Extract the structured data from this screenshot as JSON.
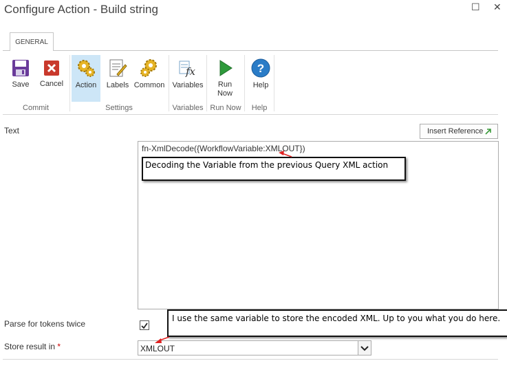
{
  "window": {
    "title": "Configure Action - Build string",
    "maximize_glyph": "☐",
    "close_glyph": "✕"
  },
  "ribbon": {
    "tab_label": "GENERAL",
    "buttons": {
      "save": "Save",
      "cancel": "Cancel",
      "action": "Action",
      "labels": "Labels",
      "common": "Common",
      "variables": "Variables",
      "run_now_1": "Run",
      "run_now_2": "Now",
      "help": "Help"
    },
    "groups": {
      "commit": "Commit",
      "settings": "Settings",
      "variables": "Variables",
      "run_now": "Run Now",
      "help": "Help"
    },
    "icons": [
      "save-icon",
      "cancel-icon",
      "action-gear-icon",
      "labels-icon",
      "common-gear-icon",
      "variables-fx-icon",
      "run-now-play-icon",
      "help-icon"
    ],
    "colors": {
      "selected": "#cde6f7",
      "help": "#2a7cc7",
      "run": "#2e9a3b",
      "cancel": "#c9392c"
    }
  },
  "form": {
    "text_label": "Text",
    "insert_reference": "Insert Reference",
    "text_value": "fn-XmlDecode({WorkflowVariable:XMLOUT})",
    "parse_label": "Parse for tokens twice",
    "parse_checked": true,
    "store_label": "Store result in",
    "required_mark": "*",
    "store_value": "XMLOUT"
  },
  "annotations": {
    "callout1": "Decoding the Variable from the previous Query XML action",
    "callout2": "I use the same variable to store the encoded XML.  Up to you what you do here."
  }
}
